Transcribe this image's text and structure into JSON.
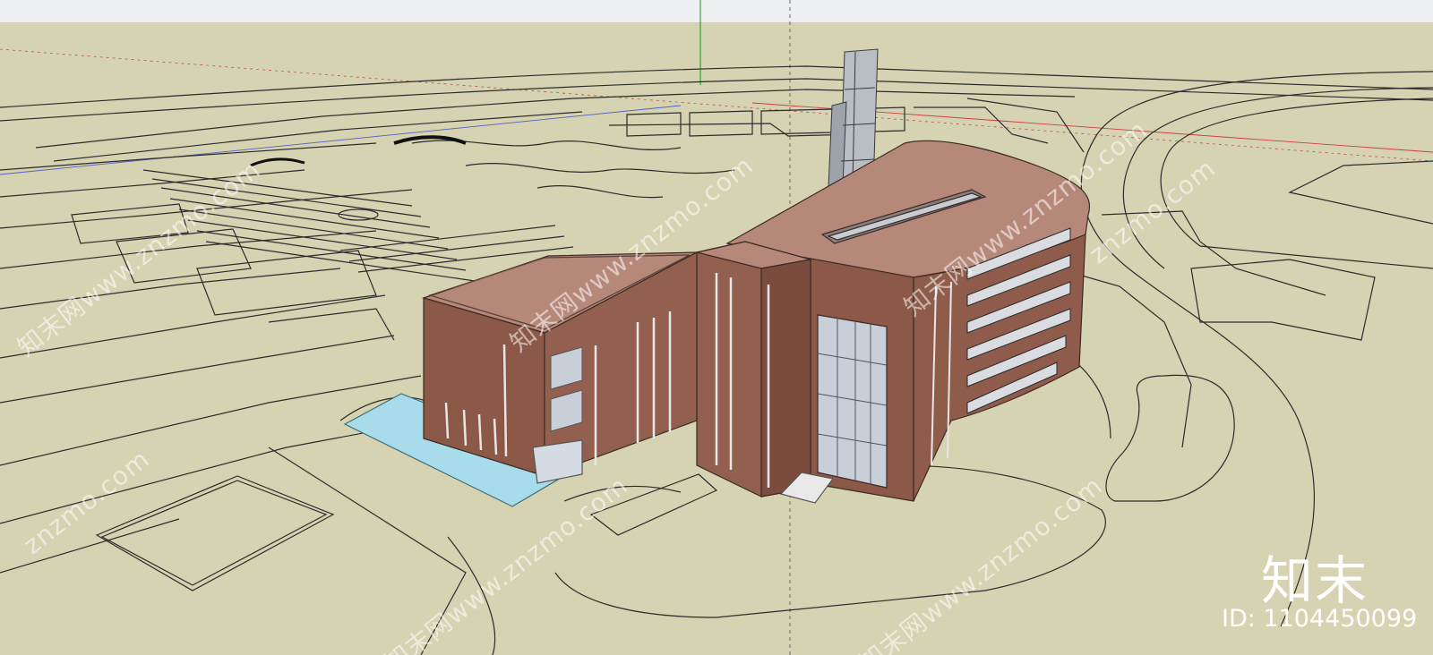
{
  "watermarks": {
    "site_text": "知末网www.znzmo.com",
    "site_text_short": "znzmo.com"
  },
  "brand": {
    "logo_text": "知末",
    "id_label": "ID: 1104450099"
  },
  "colors": {
    "ground": "#d6d3b3",
    "roof": "#b6887a",
    "wall": "#8f5b4b",
    "pool": "#a9dcea",
    "tower": "#b9bdc4",
    "glass": "#c9cfd9"
  }
}
